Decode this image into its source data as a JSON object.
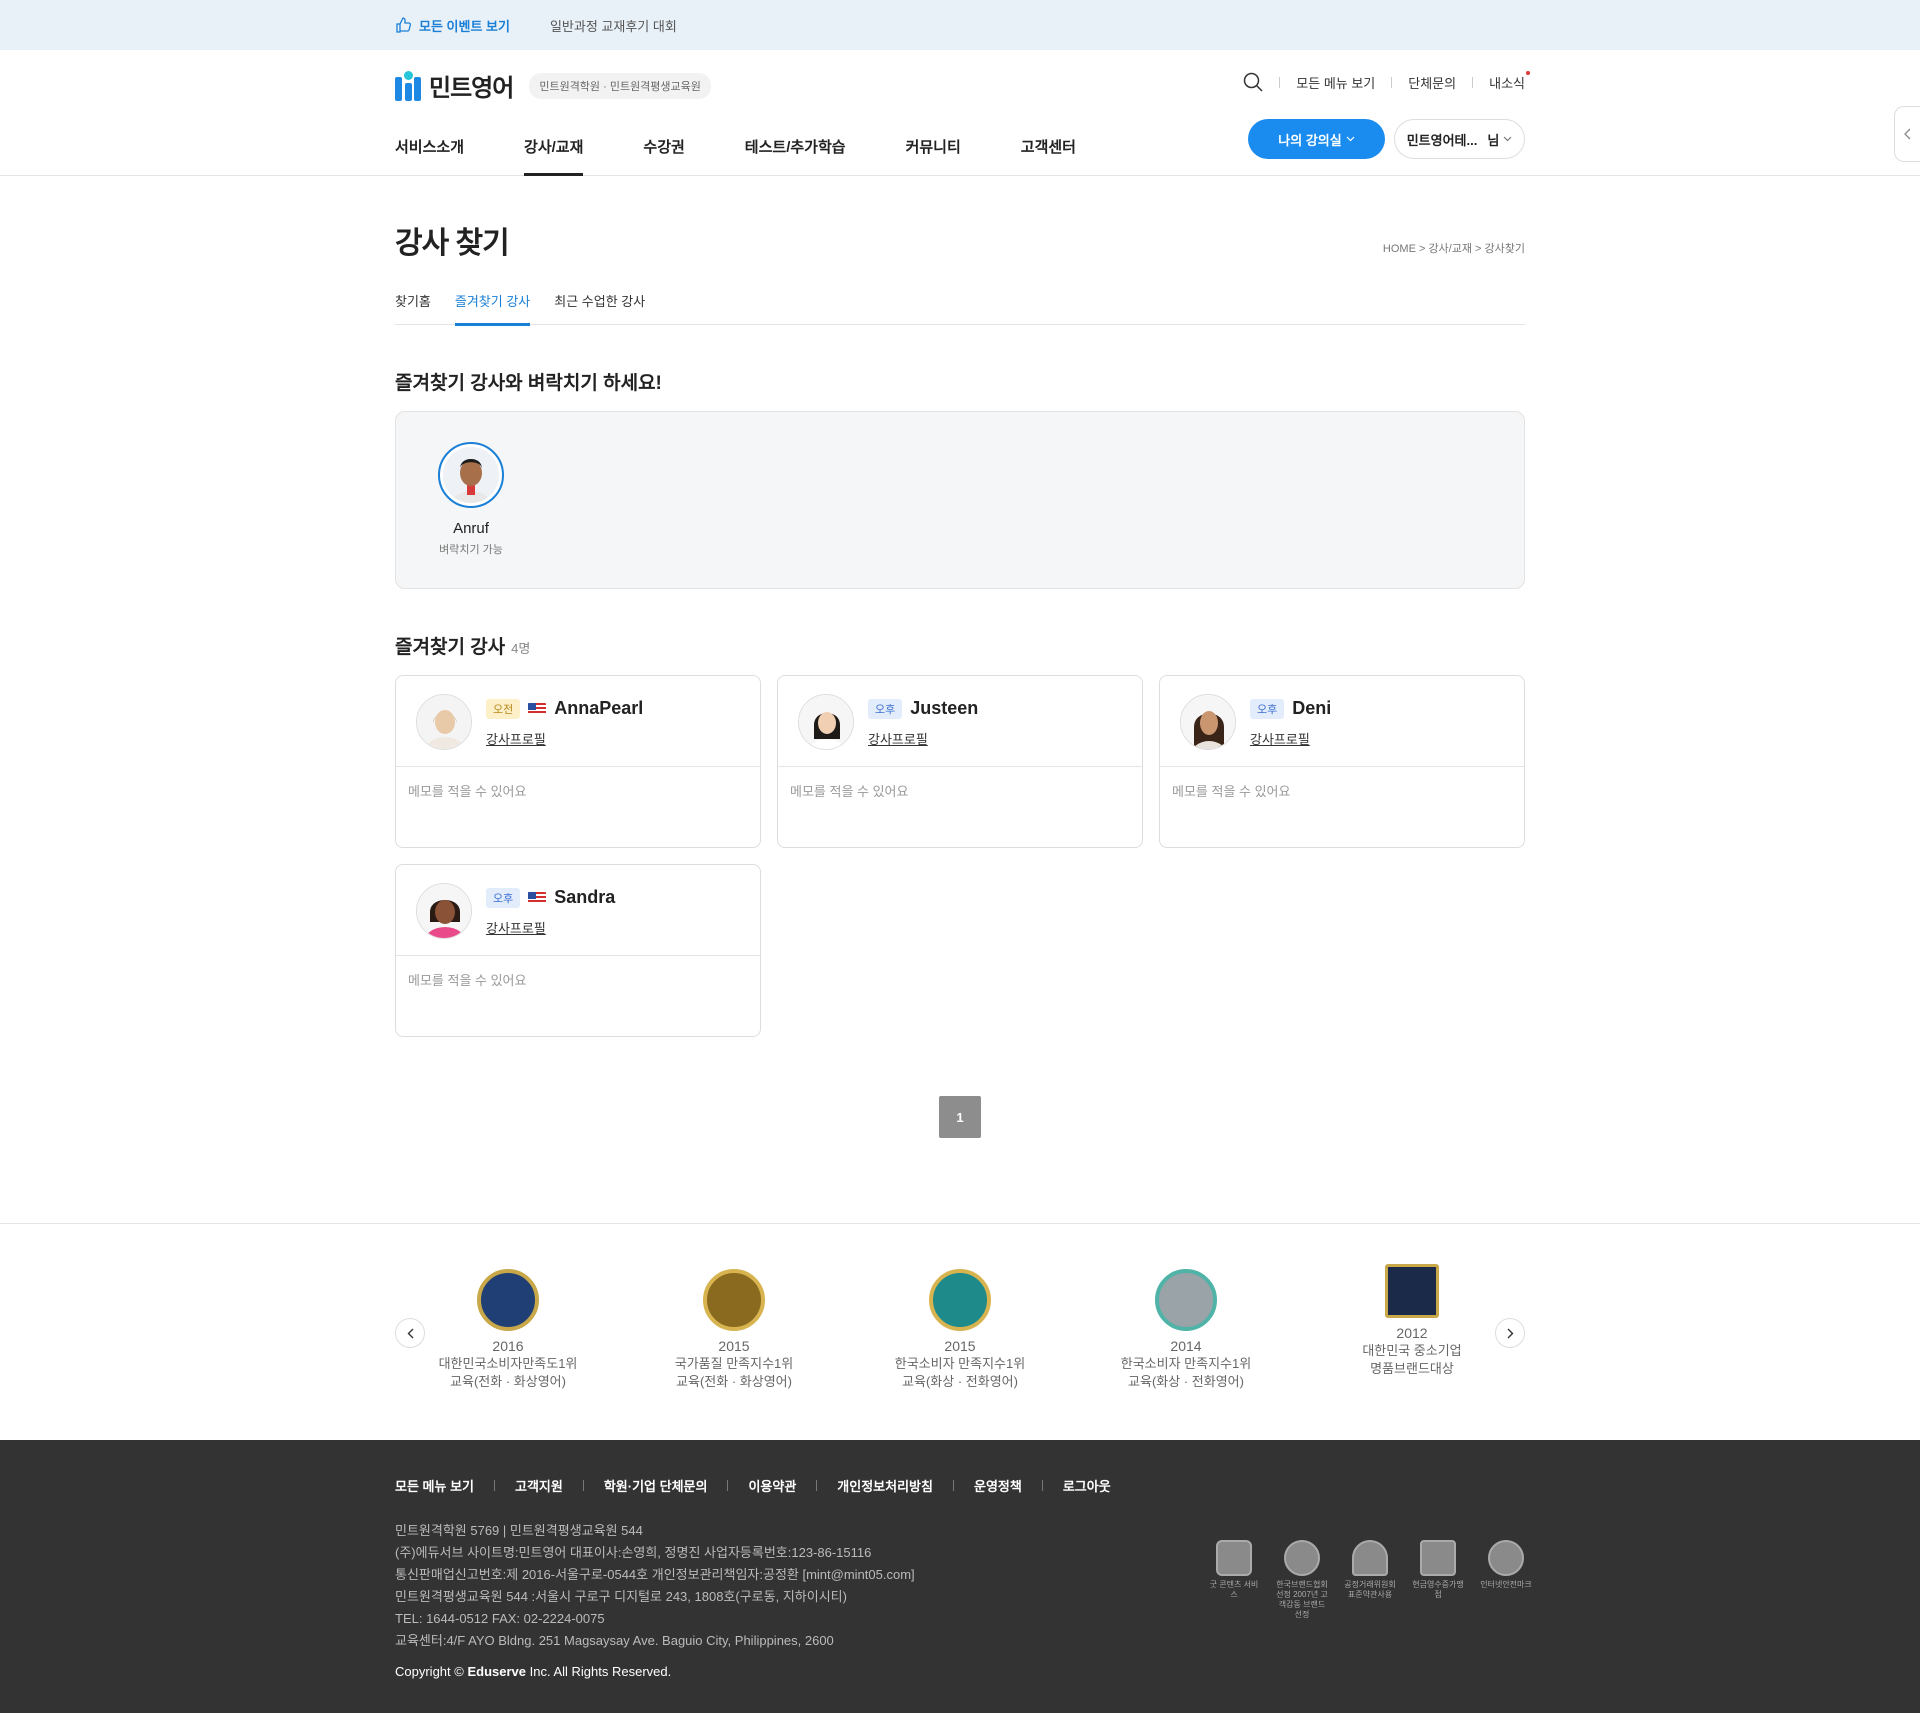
{
  "topbar": {
    "events_label": "모든 이벤트 보기",
    "contest_label": "일반과정 교재후기 대회"
  },
  "header": {
    "logo_text": "민트영어",
    "logo_sub": "민트원격학원 · 민트원격평생교육원",
    "util": {
      "menu_all": "모든 메뉴 보기",
      "group": "단체문의",
      "news": "내소식"
    },
    "gnb": [
      "서비스소개",
      "강사/교재",
      "수강권",
      "테스트/추가학습",
      "커뮤니티",
      "고객센터"
    ],
    "my_lecture": "나의 강의실",
    "user_name": "민트영어테...",
    "user_suffix": "님"
  },
  "page": {
    "title": "강사 찾기",
    "breadcrumb": "HOME > 강사/교재 > 강사찾기",
    "tabs": [
      "찾기홈",
      "즐겨찾기 강사",
      "최근 수업한 강사"
    ],
    "active_tab": "즐겨찾기 강사"
  },
  "knock": {
    "title": "즐겨찾기 강사와 벼락치기 하세요!",
    "teacher": {
      "name": "Anruf",
      "status": "벼락치기 가능"
    }
  },
  "favorites": {
    "title": "즐겨찾기 강사",
    "count": "4명",
    "profile_label": "강사프로필",
    "memo_placeholder": "메모를 적을 수 있어요",
    "teachers": [
      {
        "name": "AnnaPearl",
        "time": "오전",
        "flag": "us"
      },
      {
        "name": "Justeen",
        "time": "오후",
        "flag": ""
      },
      {
        "name": "Deni",
        "time": "오후",
        "flag": ""
      },
      {
        "name": "Sandra",
        "time": "오후",
        "flag": "us"
      }
    ]
  },
  "pagination": {
    "current": "1"
  },
  "awards": [
    {
      "year": "2016",
      "line1": "대한민국소비자만족도1위",
      "line2": "교육(전화 · 화상영어)",
      "color": "#1f3f75"
    },
    {
      "year": "2015",
      "line1": "국가품질 만족지수1위",
      "line2": "교육(전화 · 화상영어)",
      "color": "#8a6a1e"
    },
    {
      "year": "2015",
      "line1": "한국소비자 만족지수1위",
      "line2": "교육(화상 · 전화영어)",
      "color": "#1e8a8a"
    },
    {
      "year": "2014",
      "line1": "한국소비자 만족지수1위",
      "line2": "교육(화상 · 전화영어)",
      "color": "#9aa3a8"
    },
    {
      "year": "2012",
      "line1": "대한민국 중소기업",
      "line2": "명품브랜드대상",
      "color": "#1c2a4a"
    }
  ],
  "footer": {
    "nav": [
      "모든 메뉴 보기",
      "고객지원",
      "학원·기업 단체문의",
      "이용약관",
      "개인정보처리방침",
      "운영정책",
      "로그아웃"
    ],
    "info": [
      "민트원격학원 5769 | 민트원격평생교육원 544",
      "(주)에듀서브  사이트명:민트영어  대표이사:손영희, 정명진  사업자등록번호:123-86-15116",
      "통신판매업신고번호:제 2016-서울구로-0544호  개인정보관리책임자:공정환 [mint@mint05.com]",
      "민트원격평생교육원 544 :서울시 구로구 디지털로 243, 1808호(구로동, 지하이시티)",
      "TEL: 1644-0512 FAX: 02-2224-0075",
      "교육센터:4/F AYO Bldng. 251 Magsaysay Ave. Baguio City, Philippines, 2600"
    ],
    "copyright_pre": "Copyright © ",
    "copyright_brand": "Eduserve",
    "copyright_post": " Inc. All Rights Reserved.",
    "certs": [
      "굿 콘텐츠 서비스",
      "한국브랜드협회선정 2007년 고객감동 브랜드선정",
      "공정거래위원회 표준약관사용",
      "현금영수증가맹점",
      "인터넷안전마크"
    ]
  },
  "colors": {
    "accent": "#1a8cf0",
    "footer_bg": "#333333",
    "topbar_bg": "#e8f0f8"
  }
}
